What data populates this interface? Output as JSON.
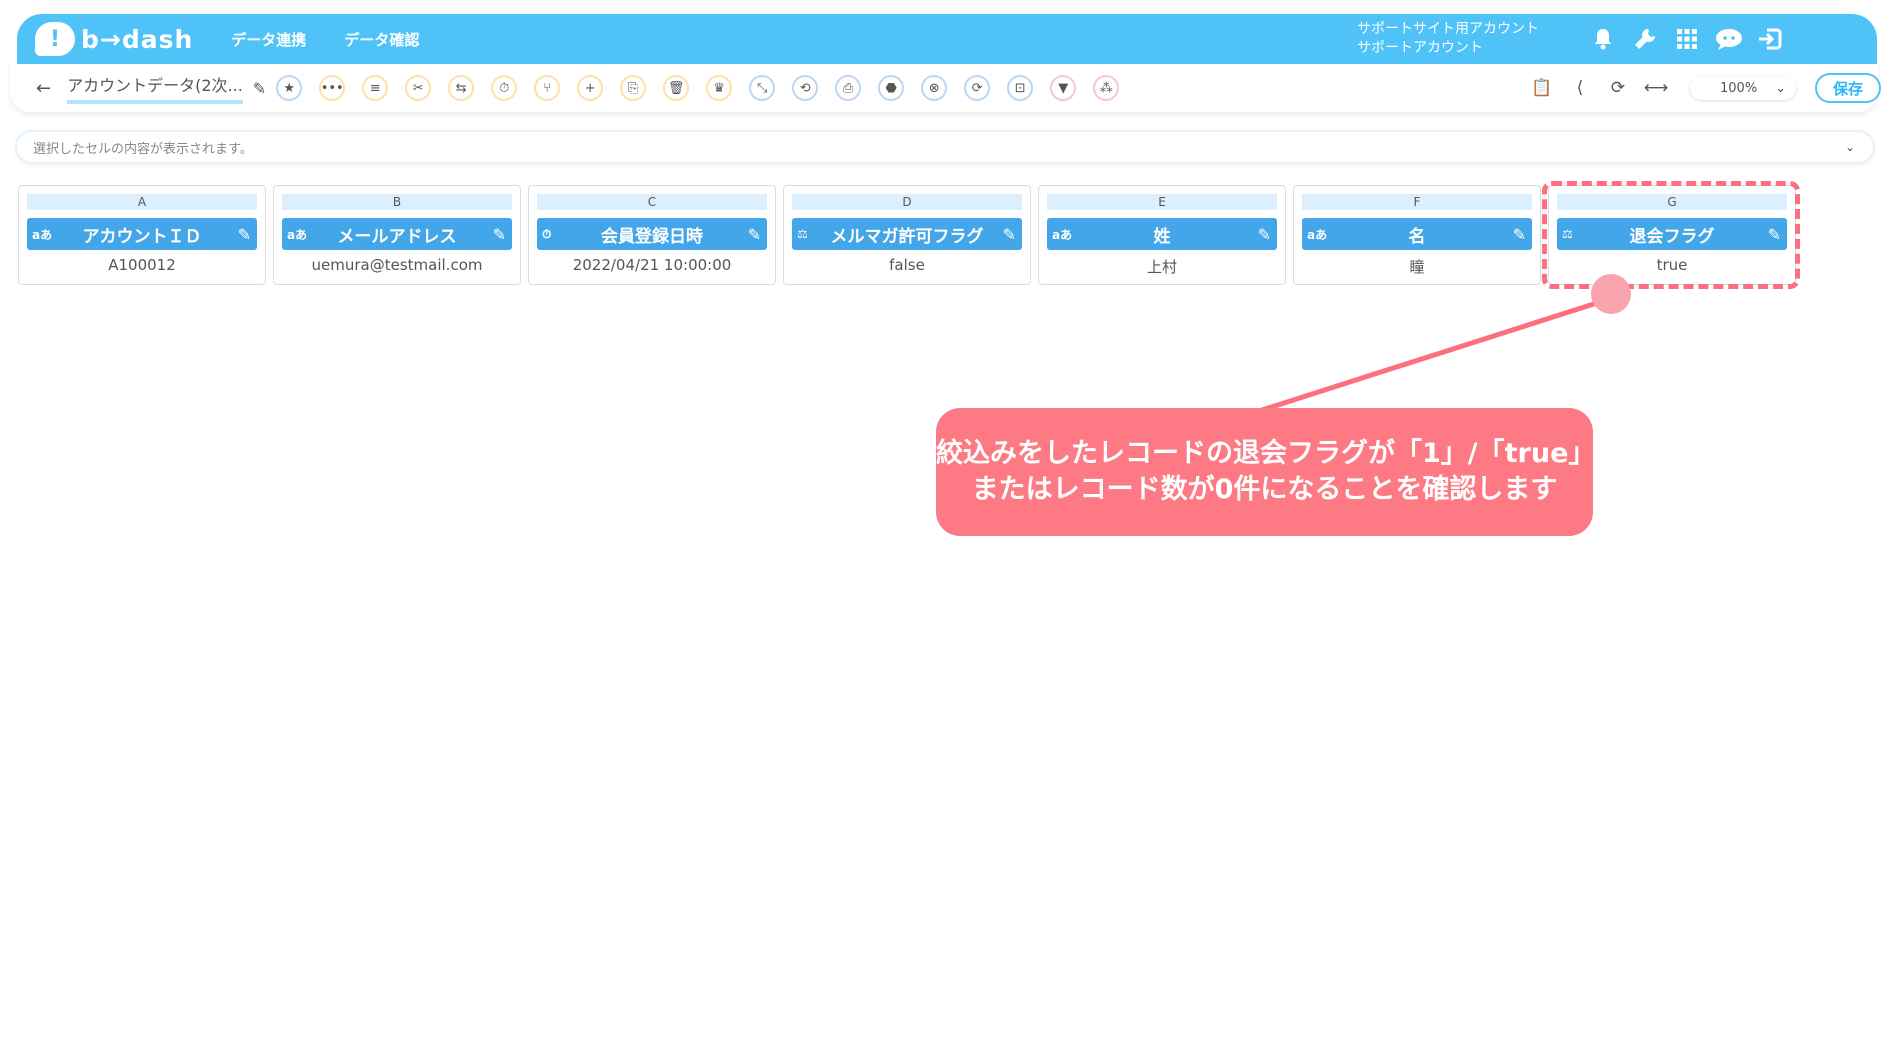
{
  "header": {
    "logo_mark": "!",
    "logo_text": "b→dash",
    "nav": [
      "データ連携",
      "データ確認"
    ],
    "account_line1": "サポートサイト用アカウント",
    "account_line2": "サポートアカウント",
    "icons": [
      "bell-icon",
      "wrench-icon",
      "grid-icon",
      "chat-icon",
      "logout-icon"
    ]
  },
  "toolbar": {
    "back": "←",
    "title": "アカウントデータ(2次...",
    "edit": "✎",
    "tools": [
      "★",
      "•••",
      "≡",
      "✂",
      "⇆",
      "⏱",
      "⑂",
      "+",
      "⎘",
      "🗑",
      "♛",
      "⤡",
      "⟲",
      "⎙",
      "⬣",
      "⊗",
      "⟳",
      "⊡",
      "▼",
      "⁂"
    ],
    "right_icons": [
      "📋",
      "⟨",
      "⟳",
      "⟷"
    ],
    "zoom": "100%",
    "save": "保存"
  },
  "content_bar": {
    "placeholder": "選択したセルの内容が表示されます。"
  },
  "columns": [
    {
      "letter": "A",
      "type": "aあ",
      "name": "アカウントＩＤ",
      "value": "A100012"
    },
    {
      "letter": "B",
      "type": "aあ",
      "name": "メールアドレス",
      "value": "uemura@testmail.com"
    },
    {
      "letter": "C",
      "type": "⏱",
      "name": "会員登録日時",
      "value": "2022/04/21 10:00:00"
    },
    {
      "letter": "D",
      "type": "⚖",
      "name": "メルマガ許可フラグ",
      "value": "false"
    },
    {
      "letter": "E",
      "type": "aあ",
      "name": "姓",
      "value": "上村"
    },
    {
      "letter": "F",
      "type": "aあ",
      "name": "名",
      "value": "瞳"
    },
    {
      "letter": "G",
      "type": "⚖",
      "name": "退会フラグ",
      "value": "true"
    }
  ],
  "callout": {
    "line1": "絞込みをしたレコードの退会フラグが「1」/「true」",
    "line2": "またはレコード数が0件になることを確認します"
  },
  "colors": {
    "header": "#4fc3f7",
    "column_head": "#43a6e8",
    "annotation": "#fb6f7e"
  }
}
